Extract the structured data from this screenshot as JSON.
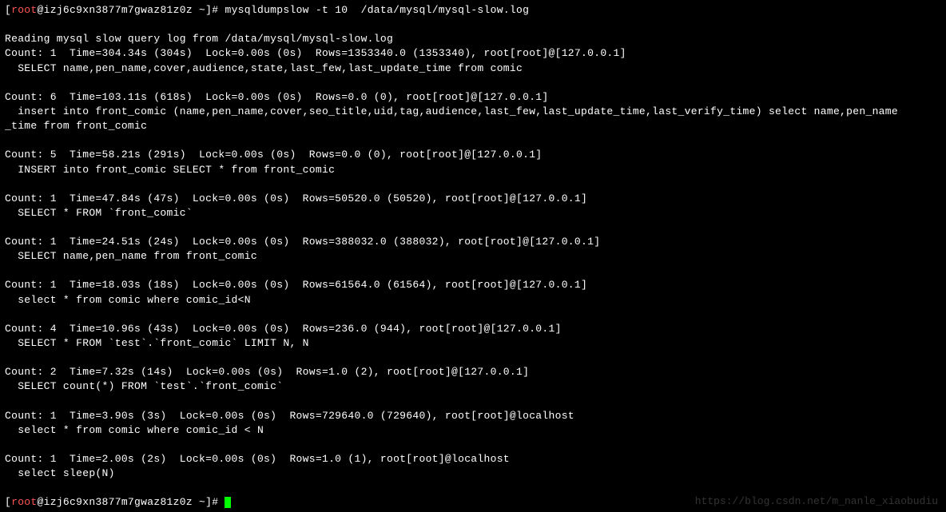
{
  "prompt": {
    "open_bracket": "[",
    "user": "root",
    "at_host": "@izj6c9xn3877m7gwaz81z0z ~",
    "close": "]# ",
    "command": "mysqldumpslow -t 10  /data/mysql/mysql-slow.log"
  },
  "lines": {
    "reading": "Reading mysql slow query log from /data/mysql/mysql-slow.log",
    "e1_header": "Count: 1  Time=304.34s (304s)  Lock=0.00s (0s)  Rows=1353340.0 (1353340), root[root]@[127.0.0.1]",
    "e1_query": "  SELECT name,pen_name,cover,audience,state,last_few,last_update_time from comic",
    "e2_header": "Count: 6  Time=103.11s (618s)  Lock=0.00s (0s)  Rows=0.0 (0), root[root]@[127.0.0.1]",
    "e2_query": "  insert into front_comic (name,pen_name,cover,seo_title,uid,tag,audience,last_few,last_update_time,last_verify_time) select name,pen_name",
    "e2_wrap": "_time from front_comic",
    "e3_header": "Count: 5  Time=58.21s (291s)  Lock=0.00s (0s)  Rows=0.0 (0), root[root]@[127.0.0.1]",
    "e3_query": "  INSERT into front_comic SELECT * from front_comic",
    "e4_header": "Count: 1  Time=47.84s (47s)  Lock=0.00s (0s)  Rows=50520.0 (50520), root[root]@[127.0.0.1]",
    "e4_query": "  SELECT * FROM `front_comic`",
    "e5_header": "Count: 1  Time=24.51s (24s)  Lock=0.00s (0s)  Rows=388032.0 (388032), root[root]@[127.0.0.1]",
    "e5_query": "  SELECT name,pen_name from front_comic",
    "e6_header": "Count: 1  Time=18.03s (18s)  Lock=0.00s (0s)  Rows=61564.0 (61564), root[root]@[127.0.0.1]",
    "e6_query": "  select * from comic where comic_id<N",
    "e7_header": "Count: 4  Time=10.96s (43s)  Lock=0.00s (0s)  Rows=236.0 (944), root[root]@[127.0.0.1]",
    "e7_query": "  SELECT * FROM `test`.`front_comic` LIMIT N, N",
    "e8_header": "Count: 2  Time=7.32s (14s)  Lock=0.00s (0s)  Rows=1.0 (2), root[root]@[127.0.0.1]",
    "e8_query": "  SELECT count(*) FROM `test`.`front_comic`",
    "e9_header": "Count: 1  Time=3.90s (3s)  Lock=0.00s (0s)  Rows=729640.0 (729640), root[root]@localhost",
    "e9_query": "  select * from comic where comic_id < N",
    "e10_header": "Count: 1  Time=2.00s (2s)  Lock=0.00s (0s)  Rows=1.0 (1), root[root]@localhost",
    "e10_query": "  select sleep(N)"
  },
  "watermark": "https://blog.csdn.net/m_nanle_xiaobudiu"
}
